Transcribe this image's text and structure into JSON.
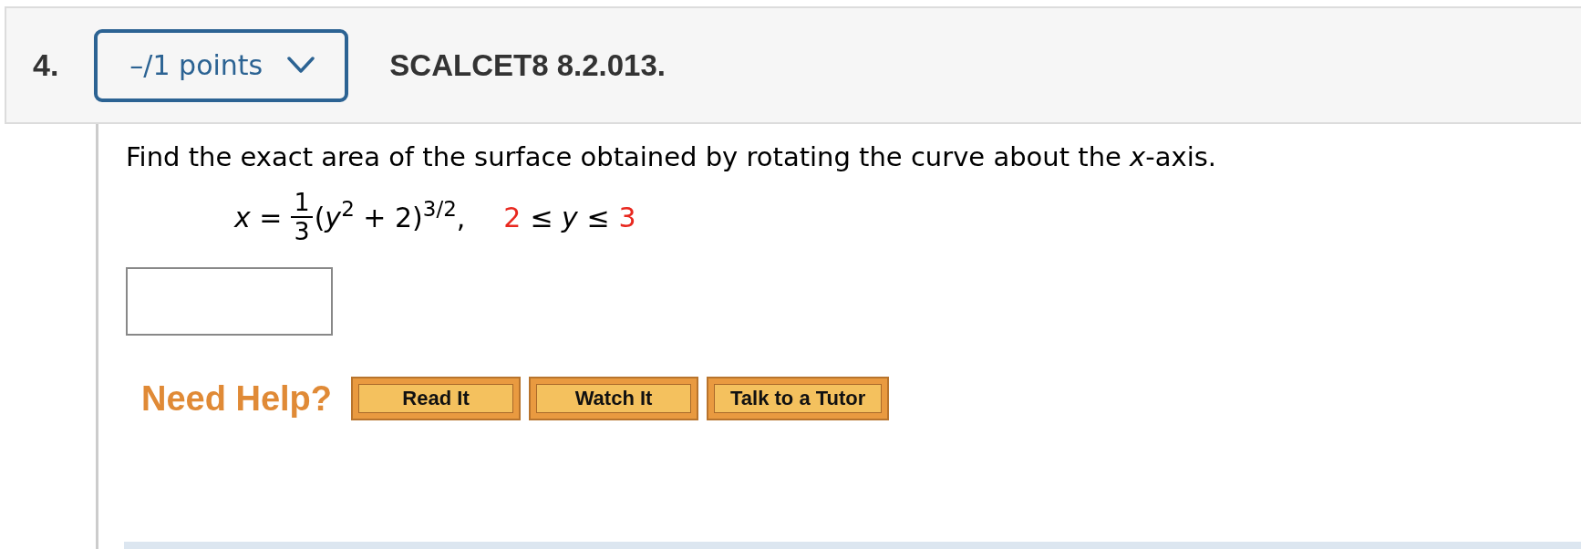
{
  "question": {
    "number": "4.",
    "points": "–/1 points",
    "code": "SCALCET8 8.2.013."
  },
  "prompt": "Find the exact area of the surface obtained by rotating the curve about the *x*-axis.",
  "equation": {
    "lhs": "*x* =",
    "fraction": {
      "numerator": "1",
      "denominator": "3"
    },
    "expression": "(*y*$^{2}$ + 2)$^{3/2}$,",
    "range": {
      "lower": "2",
      "relation": "≤ *y* ≤",
      "upper": "3"
    }
  },
  "answer": {
    "kind": "text"
  },
  "help": {
    "label": "Need Help?",
    "buttons": [
      "Read It",
      "Watch It",
      "Talk to a Tutor"
    ]
  }
}
